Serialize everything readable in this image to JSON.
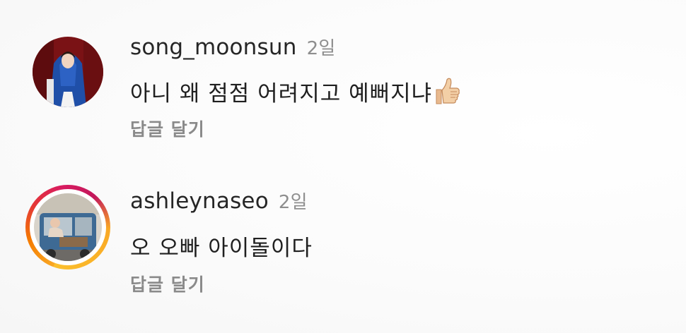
{
  "comments": [
    {
      "username": "song_moonsun",
      "time": "2일",
      "text": "아니 왜 점점 어려지고 예뻐지냐",
      "emoji": "thumbs-up",
      "reply_label": "답글 달기"
    },
    {
      "username": "ashleynaseo",
      "time": "2일",
      "text": "오 오빠 아이돌이다",
      "reply_label": "답글 달기"
    }
  ],
  "colors": {
    "username": "#262626",
    "time": "#8e8e8e",
    "reply": "#8a8a8a",
    "story_ring": "#e53935"
  }
}
